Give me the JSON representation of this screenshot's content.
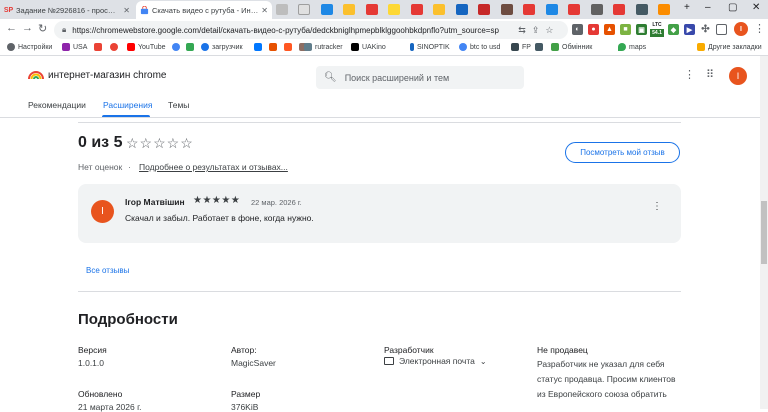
{
  "tabs": [
    {
      "label": "Задание №2926816 - просмотр з",
      "favicon": "SP",
      "active": false
    },
    {
      "label": "Скачать видео с рутуба - Интер",
      "favicon": "webstore",
      "active": true
    }
  ],
  "toolbar": {
    "url": "https://chromewebstore.google.com/detail/скачать-видео-с-рутуба/dedckbniglhpmepblklggoohbkdpnflo?utm_source=sp",
    "ext_ltc": "LTC",
    "ext_ltc_value": "54.1"
  },
  "bookmarks": [
    {
      "label": "Настройки",
      "color": "#5f6368"
    },
    {
      "label": "USA",
      "color": "#8e24aa"
    },
    {
      "label": "",
      "color": "#ea4335"
    },
    {
      "label": "",
      "color": "#ea4335"
    },
    {
      "label": "YouTube",
      "color": "#ff0000"
    },
    {
      "label": "",
      "color": "#4285f4"
    },
    {
      "label": "",
      "color": "#34a853"
    },
    {
      "label": "загрузчик",
      "color": "#1a73e8"
    },
    {
      "label": "",
      "color": "#0077ff"
    },
    {
      "label": "",
      "color": "#e65100"
    },
    {
      "label": "",
      "color": "#ff5722"
    },
    {
      "label": "",
      "color": "#8d6e63"
    },
    {
      "label": "rutracker",
      "color": "#607d8b"
    },
    {
      "label": "UAKino",
      "color": "#000000"
    },
    {
      "label": "SINOPTIK",
      "color": "#1565c0"
    },
    {
      "label": "btc to usd",
      "color": "#4285f4"
    },
    {
      "label": "FP",
      "color": "#37474f"
    },
    {
      "label": "",
      "color": "#455a64"
    },
    {
      "label": "Обмінник",
      "color": "#43a047"
    },
    {
      "label": "maps",
      "color": "#34a853"
    }
  ],
  "bookmarks_other": "Другие закладки",
  "store": {
    "title": "интернет-магазин chrome",
    "search_placeholder": "Поиск расширений и тем",
    "avatar_letter": "I",
    "nav": [
      "Рекомендации",
      "Расширения",
      "Темы"
    ]
  },
  "ratings": {
    "score": "0 из 5",
    "stars": "☆☆☆☆☆",
    "count_text": "Нет оценок",
    "dot": "·",
    "more_link": "Подробнее о результатах и отзывах...",
    "review_button": "Посмотреть мой отзыв"
  },
  "review": {
    "avatar_letter": "I",
    "author": "Ігор Матвішин",
    "stars": "★★★★★",
    "rating": 5,
    "date": "22 мар. 2026 г.",
    "text": "Скачал и забыл. Работает в фоне, когда нужно."
  },
  "all_reviews": "Все отзывы",
  "details": {
    "heading": "Подробности",
    "version_label": "Версия",
    "version": "1.0.1.0",
    "updated_label": "Обновлено",
    "updated": "21 марта 2026 г.",
    "author_label": "Автор:",
    "author": "MagicSaver",
    "size_label": "Размер",
    "size": "376KiB",
    "developer_label": "Разработчик",
    "email": "Электронная почта",
    "seller_label": "Не продавец",
    "seller_text": "Разработчик не указал для себя статус продавца. Просим клиентов из Европейского союза обратить"
  }
}
